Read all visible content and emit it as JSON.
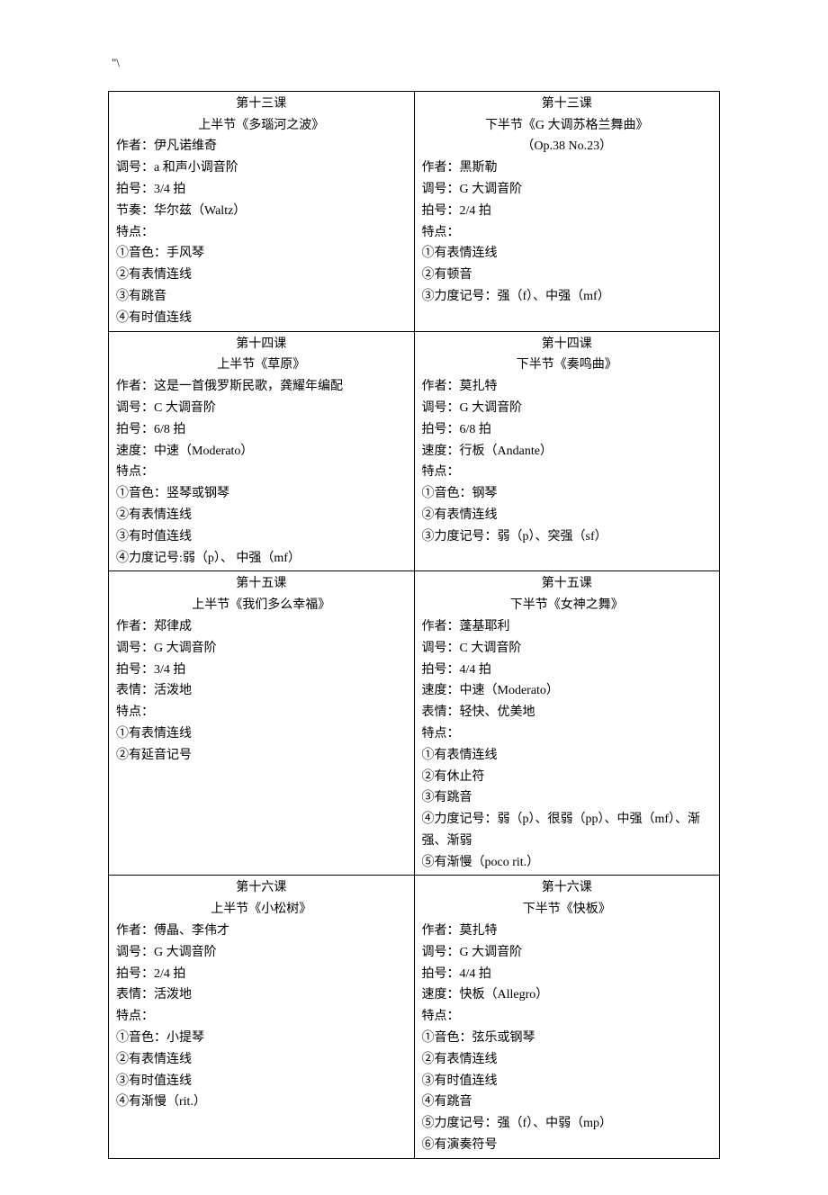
{
  "pageMarker": "\"\\",
  "cells": [
    {
      "titles": [
        "第十三课",
        "上半节《多瑙河之波》"
      ],
      "lines": [
        "作者：伊凡诺维奇",
        "调号：a 和声小调音阶",
        "拍号：3/4 拍",
        "节奏：华尔兹（Waltz）",
        "特点：",
        "①音色：手风琴",
        "②有表情连线",
        "③有跳音",
        "④有时值连线"
      ]
    },
    {
      "titles": [
        "第十三课",
        "下半节《G 大调苏格兰舞曲》",
        "（Op.38  No.23）"
      ],
      "lines": [
        "作者：黑斯勒",
        "调号：G 大调音阶",
        "拍号：2/4 拍",
        "特点：",
        "①有表情连线",
        "②有顿音",
        "③力度记号：强（f）、中强（mf）"
      ]
    },
    {
      "titles": [
        "第十四课",
        "上半节《草原》"
      ],
      "lines": [
        "作者：这是一首俄罗斯民歌，龚耀年编配",
        "调号：C 大调音阶",
        "拍号：6/8 拍",
        "速度：中速（Moderato）",
        "特点：",
        "①音色：竖琴或钢琴",
        "②有表情连线",
        "③有时值连线",
        "④力度记号:弱（p）、 中强（mf）"
      ]
    },
    {
      "titles": [
        "第十四课",
        "下半节《奏鸣曲》"
      ],
      "lines": [
        "作者：莫扎特",
        "调号：G 大调音阶",
        "拍号：6/8 拍",
        "速度：行板（Andante）",
        "特点：",
        "①音色：钢琴",
        "②有表情连线",
        "③力度记号：弱（p）、突强（sf）"
      ]
    },
    {
      "titles": [
        "第十五课",
        "上半节《我们多么幸福》"
      ],
      "lines": [
        "作者：郑律成",
        "调号：G 大调音阶",
        "拍号：3/4 拍",
        "表情：活泼地",
        "特点：",
        "①有表情连线",
        "②有延音记号"
      ]
    },
    {
      "titles": [
        "第十五课",
        "下半节《女神之舞》"
      ],
      "lines": [
        "作者：蓬基耶利",
        "调号：C 大调音阶",
        "拍号：4/4 拍",
        "速度：中速（Moderato）",
        "表情：轻快、优美地",
        "特点：",
        "①有表情连线",
        "②有休止符",
        "③有跳音",
        "④力度记号：弱（p）、很弱（pp）、中强（mf）、渐强、渐弱",
        "⑤有渐慢（poco rit.）"
      ]
    },
    {
      "titles": [
        "第十六课",
        "上半节《小松树》"
      ],
      "lines": [
        "作者：傅晶、李伟才",
        "调号：G 大调音阶",
        "拍号：2/4 拍",
        "表情：活泼地",
        "特点：",
        "①音色：小提琴",
        "②有表情连线",
        "③有时值连线",
        "④有渐慢（rit.）"
      ]
    },
    {
      "titles": [
        "第十六课",
        "下半节《快板》"
      ],
      "lines": [
        "作者：莫扎特",
        "调号：G 大调音阶",
        "拍号：4/4 拍",
        "速度：快板（Allegro）",
        "特点：",
        "①音色：弦乐或钢琴",
        "②有表情连线",
        "③有时值连线",
        "④有跳音",
        "⑤力度记号：强（f）、中弱（mp）",
        "⑥有演奏符号"
      ]
    }
  ]
}
